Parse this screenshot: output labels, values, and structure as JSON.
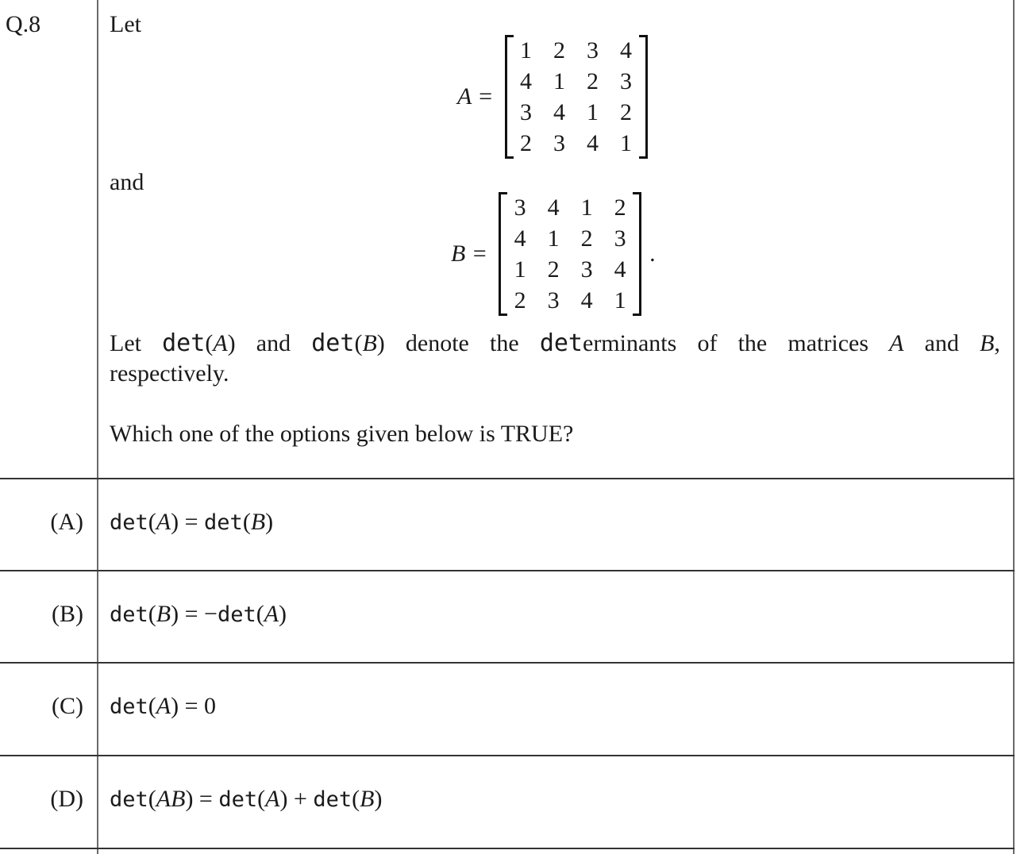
{
  "question": {
    "number": "Q.8",
    "intro": "Let",
    "connector": "and",
    "matrix_A": {
      "label": "A =",
      "rows": [
        [
          1,
          2,
          3,
          4
        ],
        [
          4,
          1,
          2,
          3
        ],
        [
          3,
          4,
          1,
          2
        ],
        [
          2,
          3,
          4,
          1
        ]
      ]
    },
    "matrix_B": {
      "label": "B =",
      "rows": [
        [
          3,
          4,
          1,
          2
        ],
        [
          4,
          1,
          2,
          3
        ],
        [
          1,
          2,
          3,
          4
        ],
        [
          2,
          3,
          4,
          1
        ]
      ],
      "trailing": "."
    },
    "statement_words": [
      "Let",
      "det(A)",
      "and",
      "det(B)",
      "denote",
      "the",
      "determinants",
      "of",
      "the",
      "matrices",
      "A",
      "and",
      "B,"
    ],
    "statement_line2": "respectively.",
    "prompt": "Which one of the options given below is TRUE?"
  },
  "options": [
    {
      "label": "(A)",
      "text": "det(A) = det(B)"
    },
    {
      "label": "(B)",
      "text": "det(B) = −det(A)"
    },
    {
      "label": "(C)",
      "text": "det(A) = 0"
    },
    {
      "label": "(D)",
      "text": "det(AB) = det(A) + det(B)"
    }
  ]
}
